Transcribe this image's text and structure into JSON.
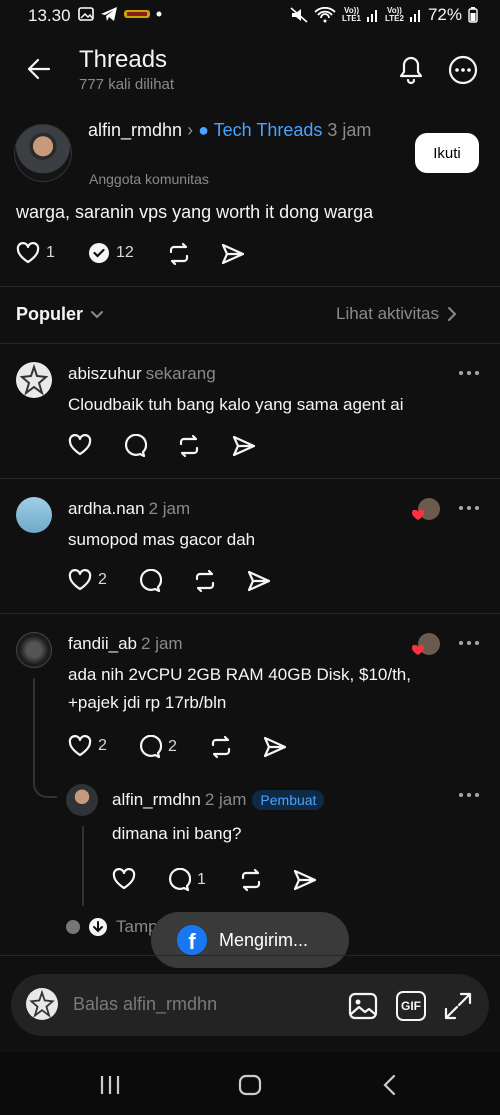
{
  "status_bar": {
    "time": "13.30",
    "battery": "72%",
    "sim1": "LTE1",
    "sim2": "LTE2",
    "volte": "Vo))"
  },
  "header": {
    "title": "Threads",
    "views": "777 kali dilihat"
  },
  "post": {
    "author": "alfin_rmdhn",
    "community": "Tech Threads",
    "time": "3 jam",
    "role": "Anggota komunitas",
    "follow_label": "Ikuti",
    "text": "warga, saranin vps yang worth it dong warga",
    "likes": "1",
    "reposts_count": "12"
  },
  "sort": {
    "label": "Populer",
    "activity_label": "Lihat aktivitas"
  },
  "replies": [
    {
      "user": "abiszuhur",
      "time": "sekarang",
      "text": "Cloudbaik tuh bang kalo yang sama agent ai",
      "likes": "",
      "comments": ""
    },
    {
      "user": "ardha.nan",
      "time": "2 jam",
      "text": "sumopod mas gacor dah",
      "likes": "2",
      "comments": ""
    },
    {
      "user": "fandii_ab",
      "time": "2 jam",
      "text_line1": "ada nih 2vCPU 2GB RAM 40GB Disk, $10/th,",
      "text_line2": "+pajek jdi rp 17rb/bln",
      "likes": "2",
      "comments": "2"
    }
  ],
  "nested_reply": {
    "user": "alfin_rmdhn",
    "time": "2 jam",
    "badge": "Pembuat",
    "text": "dimana ini bang?",
    "comments": "1"
  },
  "show_more": "Tampilkan balasan",
  "toast": {
    "label": "Mengirim..."
  },
  "reply_bar": {
    "placeholder": "Balas alfin_rmdhn",
    "gif_label": "GIF"
  },
  "colors": {
    "background": "#101010",
    "accent": "#4aa3ff",
    "text": "#f3f5f7",
    "muted": "#8a8a8a",
    "heart_red": "#ff3040"
  }
}
